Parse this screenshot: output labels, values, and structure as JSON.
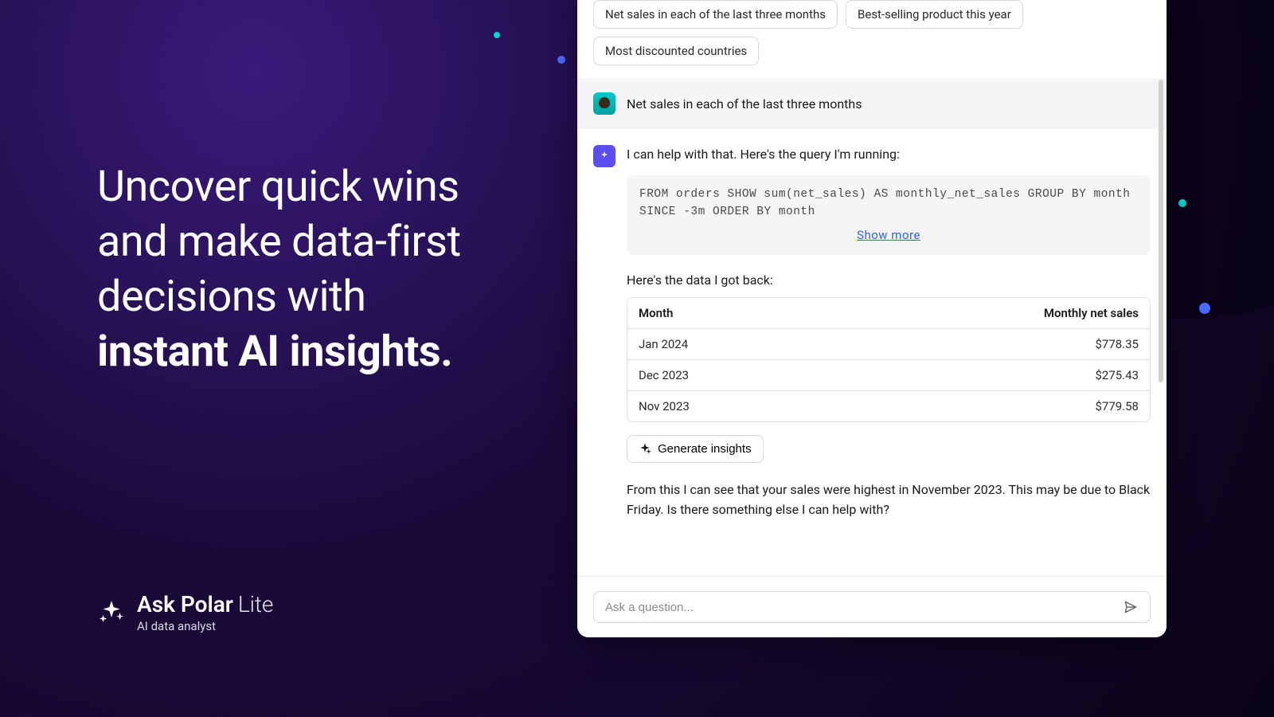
{
  "hero": {
    "line1": "Uncover quick wins",
    "line2": "and make data-first",
    "line3": "decisions with",
    "bold": "instant AI insights."
  },
  "brand": {
    "name": "Ask Polar",
    "tier": "Lite",
    "tagline": "AI data analyst"
  },
  "chips": [
    "Net sales in each of the last three months",
    "Best-selling product this year",
    "Most discounted countries"
  ],
  "user_message": "Net sales in each of the last three months",
  "ai": {
    "intro": "I can help with that. Here's the query I'm running:",
    "query": "FROM orders SHOW sum(net_sales) AS monthly_net_sales GROUP BY month SINCE -3m ORDER BY month",
    "show_more": "Show more",
    "data_intro": "Here's the data I got back:",
    "table": {
      "headers": [
        "Month",
        "Monthly net sales"
      ],
      "rows": [
        [
          "Jan 2024",
          "$778.35"
        ],
        [
          "Dec 2023",
          "$275.43"
        ],
        [
          "Nov 2023",
          "$779.58"
        ]
      ]
    },
    "generate_label": "Generate insights",
    "summary": "From this I can see that your sales were highest in November 2023. This may be due to Black Friday. Is there something else I can help with?"
  },
  "input": {
    "placeholder": "Ask a question..."
  }
}
